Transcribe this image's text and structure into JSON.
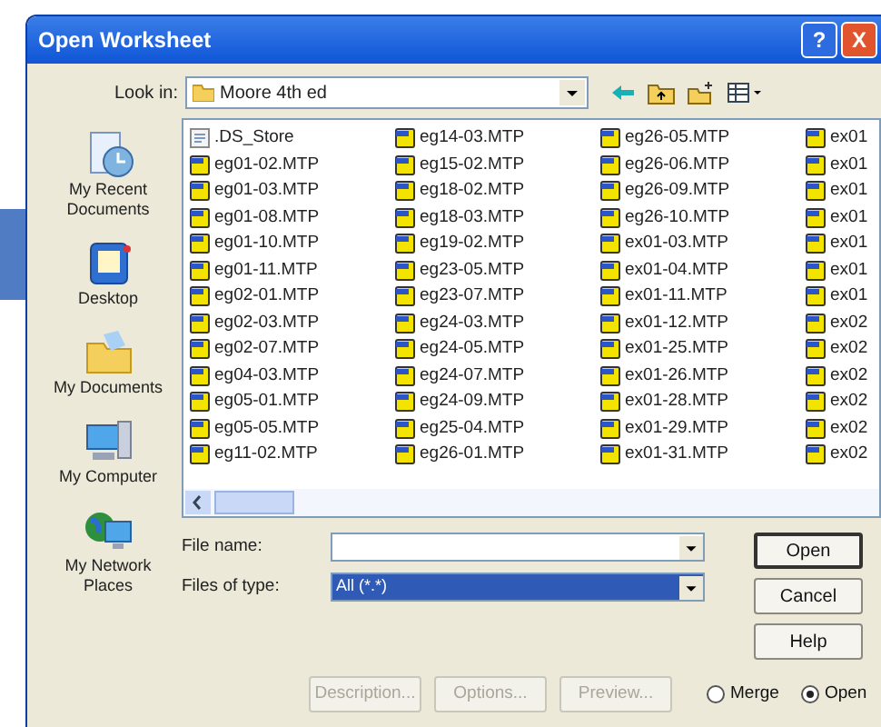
{
  "window": {
    "title": "Open Worksheet"
  },
  "title_buttons": [
    "?",
    "X"
  ],
  "look_in": {
    "label": "Look in:",
    "value": "Moore 4th ed"
  },
  "places": [
    {
      "label": "My Recent Documents",
      "kind": "recent"
    },
    {
      "label": "Desktop",
      "kind": "desktop"
    },
    {
      "label": "My Documents",
      "kind": "documents"
    },
    {
      "label": "My Computer",
      "kind": "computer"
    },
    {
      "label": "My Network Places",
      "kind": "network"
    }
  ],
  "file_columns": [
    [
      {
        "name": ".DS_Store",
        "kind": "generic"
      },
      {
        "name": "eg01-02.MTP",
        "kind": "mtp"
      },
      {
        "name": "eg01-03.MTP",
        "kind": "mtp"
      },
      {
        "name": "eg01-08.MTP",
        "kind": "mtp"
      },
      {
        "name": "eg01-10.MTP",
        "kind": "mtp"
      },
      {
        "name": "eg01-11.MTP",
        "kind": "mtp"
      },
      {
        "name": "eg02-01.MTP",
        "kind": "mtp"
      },
      {
        "name": "eg02-03.MTP",
        "kind": "mtp"
      },
      {
        "name": "eg02-07.MTP",
        "kind": "mtp"
      },
      {
        "name": "eg04-03.MTP",
        "kind": "mtp"
      },
      {
        "name": "eg05-01.MTP",
        "kind": "mtp"
      },
      {
        "name": "eg05-05.MTP",
        "kind": "mtp"
      },
      {
        "name": "eg11-02.MTP",
        "kind": "mtp"
      }
    ],
    [
      {
        "name": "eg14-03.MTP",
        "kind": "mtp"
      },
      {
        "name": "eg15-02.MTP",
        "kind": "mtp"
      },
      {
        "name": "eg18-02.MTP",
        "kind": "mtp"
      },
      {
        "name": "eg18-03.MTP",
        "kind": "mtp"
      },
      {
        "name": "eg19-02.MTP",
        "kind": "mtp"
      },
      {
        "name": "eg23-05.MTP",
        "kind": "mtp"
      },
      {
        "name": "eg23-07.MTP",
        "kind": "mtp"
      },
      {
        "name": "eg24-03.MTP",
        "kind": "mtp"
      },
      {
        "name": "eg24-05.MTP",
        "kind": "mtp"
      },
      {
        "name": "eg24-07.MTP",
        "kind": "mtp"
      },
      {
        "name": "eg24-09.MTP",
        "kind": "mtp"
      },
      {
        "name": "eg25-04.MTP",
        "kind": "mtp"
      },
      {
        "name": "eg26-01.MTP",
        "kind": "mtp"
      }
    ],
    [
      {
        "name": "eg26-05.MTP",
        "kind": "mtp"
      },
      {
        "name": "eg26-06.MTP",
        "kind": "mtp"
      },
      {
        "name": "eg26-09.MTP",
        "kind": "mtp"
      },
      {
        "name": "eg26-10.MTP",
        "kind": "mtp"
      },
      {
        "name": "ex01-03.MTP",
        "kind": "mtp"
      },
      {
        "name": "ex01-04.MTP",
        "kind": "mtp"
      },
      {
        "name": "ex01-11.MTP",
        "kind": "mtp"
      },
      {
        "name": "ex01-12.MTP",
        "kind": "mtp"
      },
      {
        "name": "ex01-25.MTP",
        "kind": "mtp"
      },
      {
        "name": "ex01-26.MTP",
        "kind": "mtp"
      },
      {
        "name": "ex01-28.MTP",
        "kind": "mtp"
      },
      {
        "name": "ex01-29.MTP",
        "kind": "mtp"
      },
      {
        "name": "ex01-31.MTP",
        "kind": "mtp"
      }
    ],
    [
      {
        "name": "ex01",
        "kind": "mtp"
      },
      {
        "name": "ex01",
        "kind": "mtp"
      },
      {
        "name": "ex01",
        "kind": "mtp"
      },
      {
        "name": "ex01",
        "kind": "mtp"
      },
      {
        "name": "ex01",
        "kind": "mtp"
      },
      {
        "name": "ex01",
        "kind": "mtp"
      },
      {
        "name": "ex01",
        "kind": "mtp"
      },
      {
        "name": "ex02",
        "kind": "mtp"
      },
      {
        "name": "ex02",
        "kind": "mtp"
      },
      {
        "name": "ex02",
        "kind": "mtp"
      },
      {
        "name": "ex02",
        "kind": "mtp"
      },
      {
        "name": "ex02",
        "kind": "mtp"
      },
      {
        "name": "ex02",
        "kind": "mtp"
      }
    ]
  ],
  "file_name": {
    "label": "File name:"
  },
  "files_of_type": {
    "label": "Files of type:",
    "value": "All (*.*)",
    "highlighted": true
  },
  "side_buttons": [
    {
      "label": "Open",
      "default": true
    },
    {
      "label": "Cancel",
      "default": false
    },
    {
      "label": "Help",
      "default": false
    }
  ],
  "bottom_buttons": [
    {
      "label": "Description...",
      "disabled": true
    },
    {
      "label": "Options...",
      "disabled": true
    },
    {
      "label": "Preview...",
      "disabled": true
    }
  ],
  "modes": [
    {
      "label": "Merge",
      "selected": false
    },
    {
      "label": "Open",
      "selected": true
    }
  ]
}
